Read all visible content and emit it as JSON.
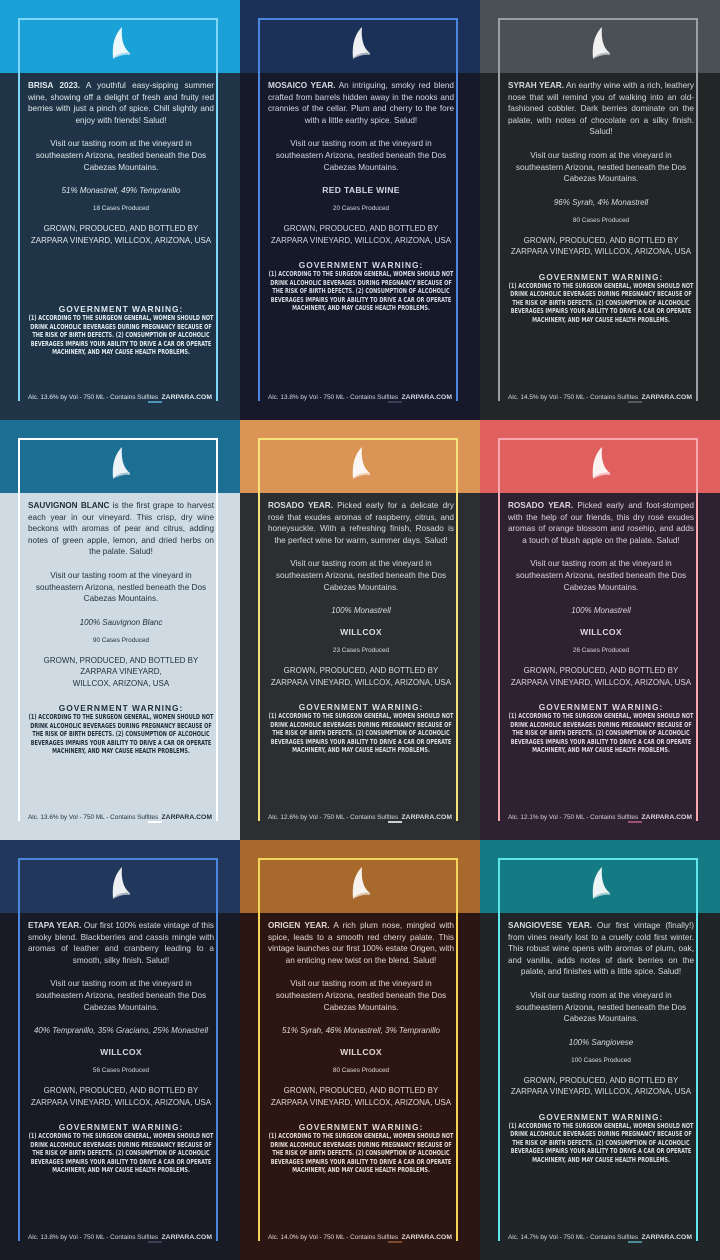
{
  "labels": [
    {
      "id": "brisa",
      "band": "#1aa1d7",
      "body": "#1f3446",
      "frame": "#7fd6f5",
      "text": "#dfe8ee",
      "foot_line": "#4f95b8",
      "name": "BRISA 2023.",
      "desc": "A youthful easy-sipping summer wine, showing off a delight of fresh and fruity red berries with just a pinch of spice. Chill slightly and enjoy with friends! Salud!",
      "visit": "Visit our tasting room at the vineyard in southeastern Arizona, nestled beneath the Dos Cabezas Mountains.",
      "varietal": "51% Monastrell, 49% Tempranillo",
      "brand": "",
      "cases": "18 Cases Produced",
      "grown": "GROWN, PRODUCED, AND BOTTLED BY\nZARPARA VINEYARD, WILLCOX, ARIZONA, USA",
      "warn_gap": true,
      "alc": "Alc. 13.6% by Vol - 750 ML - Contains Sulfites",
      "site": "ZARPARA.COM"
    },
    {
      "id": "mosaico",
      "band": "#1c3157",
      "body": "#16192a",
      "frame": "#4d86e0",
      "text": "#d4d7e0",
      "foot_line": "#3a3f55",
      "name": "MOSAICO YEAR.",
      "desc": "An intriguing, smoky red blend crafted from barrels hidden away in the nooks and crannies of the cellar. Plum and cherry to the fore with a little earthy spice. Salud!",
      "visit": "Visit our tasting room at the vineyard in southeastern Arizona, nestled beneath the Dos Cabezas Mountains.",
      "varietal": "",
      "brand": "RED TABLE WINE",
      "cases": "20 Cases Produced",
      "grown": "GROWN, PRODUCED, AND BOTTLED BY\nZARPARA VINEYARD, WILLCOX, ARIZONA, USA",
      "warn_gap": false,
      "alc": "Alc. 13.8% by Vol - 750 ML - Contains Sulfites",
      "site": "ZARPARA.COM"
    },
    {
      "id": "syrah",
      "band": "#4b5057",
      "body": "#232527",
      "frame": "#9aa0a6",
      "text": "#d6d8da",
      "foot_line": "#55595d",
      "name": "SYRAH YEAR.",
      "desc": "An earthy wine with a rich, leathery nose that will remind you of walking into an old-fashioned cobbler. Dark berries dominate on the palate, with notes of chocolate on a silky finish. Salud!",
      "visit": "Visit our tasting room at the vineyard in southeastern Arizona, nestled beneath the Dos Cabezas Mountains.",
      "varietal": "96% Syrah, 4% Monastrell",
      "brand": "",
      "cases": "80 Cases Produced",
      "grown": "GROWN, PRODUCED, AND BOTTLED BY\nZARPARA VINEYARD, WILLCOX, ARIZONA, USA",
      "warn_gap": false,
      "alc": "Alc. 14.5% by Vol - 750 ML - Contains Sulfites",
      "site": "ZARPARA.COM"
    },
    {
      "id": "sauvignon",
      "band": "#1d6e93",
      "body": "#cfdae3",
      "frame": "#ffffff",
      "text": "#1e2e3c",
      "foot_line": "#ffffff",
      "name": "SAUVIGNON BLANC",
      "desc": "is the first grape to harvest each year in our vineyard. This crisp, dry wine beckons with aromas of pear and citrus, adding notes of green apple, lemon, and dried herbs on the palate. Salud!",
      "visit": "Visit our tasting room at the vineyard in southeastern Arizona, nestled beneath the Dos Cabezas Mountains.",
      "varietal": "100% Sauvignon Blanc",
      "brand": "",
      "cases": "90 Cases Produced",
      "grown": "GROWN, PRODUCED, AND BOTTLED BY\nZARPARA VINEYARD,\nWILLCOX, ARIZONA, USA",
      "warn_gap": false,
      "alc": "Alc. 13.6% by Vol - 750 ML - Contains Sulfites",
      "site": "ZARPARA.COM"
    },
    {
      "id": "rosado1",
      "band": "#d99456",
      "body": "#2b2f31",
      "frame": "#f6e27a",
      "text": "#dadcdd",
      "foot_line": "#d0d0d0",
      "name": "ROSADO YEAR.",
      "desc": "Picked early for a delicate dry rosé that exudes aromas of raspberry, citrus, and honeysuckle. With a refreshing finish, Rosado is the perfect wine for warm, summer days. Salud!",
      "visit": "Visit our tasting room at the vineyard in southeastern Arizona, nestled beneath the Dos Cabezas Mountains.",
      "varietal": "100% Monastrell",
      "brand": "WILLCOX",
      "cases": "23 Cases Produced",
      "grown": "GROWN, PRODUCED, AND BOTTLED BY\nZARPARA VINEYARD, WILLCOX, ARIZONA, USA",
      "warn_gap": false,
      "alc": "Alc. 12.6% by Vol - 750 ML - Contains Sulfites",
      "site": "ZARPARA.COM"
    },
    {
      "id": "rosado2",
      "band": "#e0605f",
      "body": "#2e2232",
      "frame": "#f6a8b0",
      "text": "#dcd4dc",
      "foot_line": "#a0506e",
      "name": "ROSADO YEAR.",
      "desc": "Picked early and foot-stomped with the help of our friends, this dry rosé exudes aromas of orange blossom and rosehip, and adds a touch of blush apple on the palate. Salud!",
      "visit": "Visit our tasting room at the vineyard in southeastern Arizona, nestled beneath the Dos Cabezas Mountains.",
      "varietal": "100% Monastrell",
      "brand": "WILLCOX",
      "cases": "26 Cases Produced",
      "grown": "GROWN, PRODUCED, AND BOTTLED BY\nZARPARA VINEYARD, WILLCOX, ARIZONA, USA",
      "warn_gap": false,
      "alc": "Alc. 12.1% by Vol - 750 ML - Contains Sulfites",
      "site": "ZARPARA.COM"
    },
    {
      "id": "etapa",
      "band": "#21375c",
      "body": "#181b25",
      "frame": "#4d86e0",
      "text": "#d4d7e0",
      "foot_line": "#3a3f55",
      "name": "ETAPA YEAR.",
      "desc": "Our first 100% estate vintage of this smoky blend. Blackberries and cassis mingle with aromas of leather and cranberry leading to a smooth, silky finish. Salud!",
      "visit": "Visit our tasting room at the vineyard in southeastern Arizona, nestled beneath the Dos Cabezas Mountains.",
      "varietal": "40% Tempranillo, 35% Graciano, 25% Monastrell",
      "brand": "WILLCOX",
      "cases": "56 Cases Produced",
      "grown": "GROWN, PRODUCED, AND BOTTLED BY\nZARPARA VINEYARD, WILLCOX, ARIZONA, USA",
      "warn_gap": false,
      "alc": "Alc. 13.8% by Vol - 750 ML - Contains Sulfites",
      "site": "ZARPARA.COM"
    },
    {
      "id": "origen",
      "band": "#a86a2c",
      "body": "#2b1613",
      "frame": "#f6d45a",
      "text": "#e0d6d2",
      "foot_line": "#7a4a2a",
      "name": "ORIGEN YEAR.",
      "desc": "A rich plum nose, mingled with spice, leads to a smooth red cherry palate. This vintage launches our first 100% estate Origen, with an enticing new twist on the blend. Salud!",
      "visit": "Visit our tasting room at the vineyard in southeastern Arizona, nestled beneath the Dos Cabezas Mountains.",
      "varietal": "51% Syrah, 46% Monastrell, 3% Tempranillo",
      "brand": "WILLCOX",
      "cases": "80 Cases Produced",
      "grown": "GROWN, PRODUCED, AND BOTTLED BY\nZARPARA VINEYARD, WILLCOX, ARIZONA, USA",
      "warn_gap": false,
      "alc": "Alc. 14.0% by Vol - 750 ML - Contains Sulfites",
      "site": "ZARPARA.COM"
    },
    {
      "id": "sangiovese",
      "band": "#147b85",
      "body": "#202628",
      "frame": "#5fe6ec",
      "text": "#d6dcdd",
      "foot_line": "#4a8e94",
      "name": "SANGIOVESE YEAR.",
      "desc": "Our first vintage (finally!) from vines nearly lost to a cruelly cold first winter. This robust wine opens with aromas of plum, oak, and vanilla, adds notes of dark berries on the palate, and finishes with a little spice. Salud!",
      "visit": "Visit our tasting room at the vineyard in southeastern Arizona, nestled beneath the Dos Cabezas Mountains.",
      "varietal": "100% Sangiovese",
      "brand": "",
      "cases": "100 Cases Produced",
      "grown": "GROWN, PRODUCED, AND BOTTLED BY\nZARPARA VINEYARD, WILLCOX, ARIZONA, USA",
      "warn_gap": false,
      "alc": "Alc. 14.7% by Vol - 750 ML - Contains Sulfites",
      "site": "ZARPARA.COM"
    }
  ],
  "warning_title": "GOVERNMENT WARNING:",
  "warning_text": "(1) ACCORDING TO THE SURGEON GENERAL, WOMEN SHOULD NOT DRINK ALCOHOLIC BEVERAGES DURING PREGNANCY BECAUSE OF THE RISK OF BIRTH DEFECTS. (2) CONSUMPTION OF ALCOHOLIC BEVERAGES IMPAIRS YOUR ABILITY TO DRIVE A CAR OR OPERATE MACHINERY, AND MAY CAUSE HEALTH PROBLEMS.",
  "logo_icon": "sail-logo-icon"
}
